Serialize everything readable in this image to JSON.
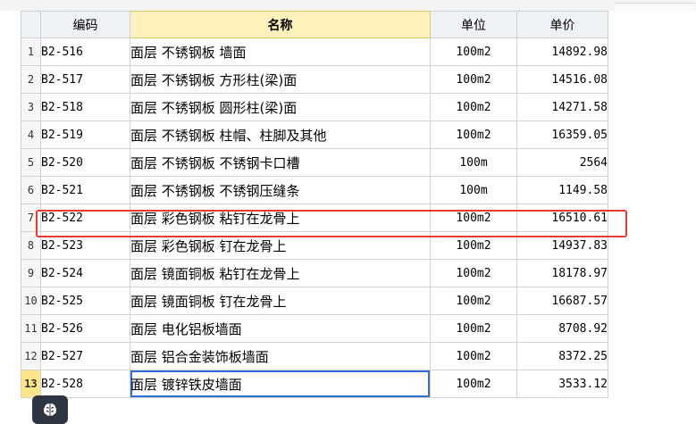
{
  "columns": {
    "code": "编码",
    "name": "名称",
    "unit": "单位",
    "price": "单价"
  },
  "rows": [
    {
      "num": "1",
      "code": "B2-516",
      "name": "面层 不锈钢板 墙面",
      "unit": "100m2",
      "price": "14892.98"
    },
    {
      "num": "2",
      "code": "B2-517",
      "name": "面层 不锈钢板 方形柱(梁)面",
      "unit": "100m2",
      "price": "14516.08"
    },
    {
      "num": "3",
      "code": "B2-518",
      "name": "面层 不锈钢板 圆形柱(梁)面",
      "unit": "100m2",
      "price": "14271.58"
    },
    {
      "num": "4",
      "code": "B2-519",
      "name": "面层 不锈钢板 柱帽、柱脚及其他",
      "unit": "100m2",
      "price": "16359.05"
    },
    {
      "num": "5",
      "code": "B2-520",
      "name": "面层 不锈钢板 不锈钢卡口槽",
      "unit": "100m",
      "price": "2564"
    },
    {
      "num": "6",
      "code": "B2-521",
      "name": "面层 不锈钢板 不锈钢压缝条",
      "unit": "100m",
      "price": "1149.58"
    },
    {
      "num": "7",
      "code": "B2-522",
      "name": "面层 彩色钢板 粘钉在龙骨上",
      "unit": "100m2",
      "price": "16510.61"
    },
    {
      "num": "8",
      "code": "B2-523",
      "name": "面层 彩色钢板 钉在龙骨上",
      "unit": "100m2",
      "price": "14937.83"
    },
    {
      "num": "9",
      "code": "B2-524",
      "name": "面层 镜面铜板 粘钉在龙骨上",
      "unit": "100m2",
      "price": "18178.97"
    },
    {
      "num": "10",
      "code": "B2-525",
      "name": "面层 镜面铜板 钉在龙骨上",
      "unit": "100m2",
      "price": "16687.57"
    },
    {
      "num": "11",
      "code": "B2-526",
      "name": "面层 电化铝板墙面",
      "unit": "100m2",
      "price": "8708.92"
    },
    {
      "num": "12",
      "code": "B2-527",
      "name": "面层 铝合金装饰板墙面",
      "unit": "100m2",
      "price": "8372.25"
    },
    {
      "num": "13",
      "code": "B2-528",
      "name": "面层 镀锌铁皮墙面",
      "unit": "100m2",
      "price": "3533.12"
    }
  ],
  "highlight_color": "#e43c2f",
  "selected_row": "13",
  "floating_button_icon": "brain-icon"
}
